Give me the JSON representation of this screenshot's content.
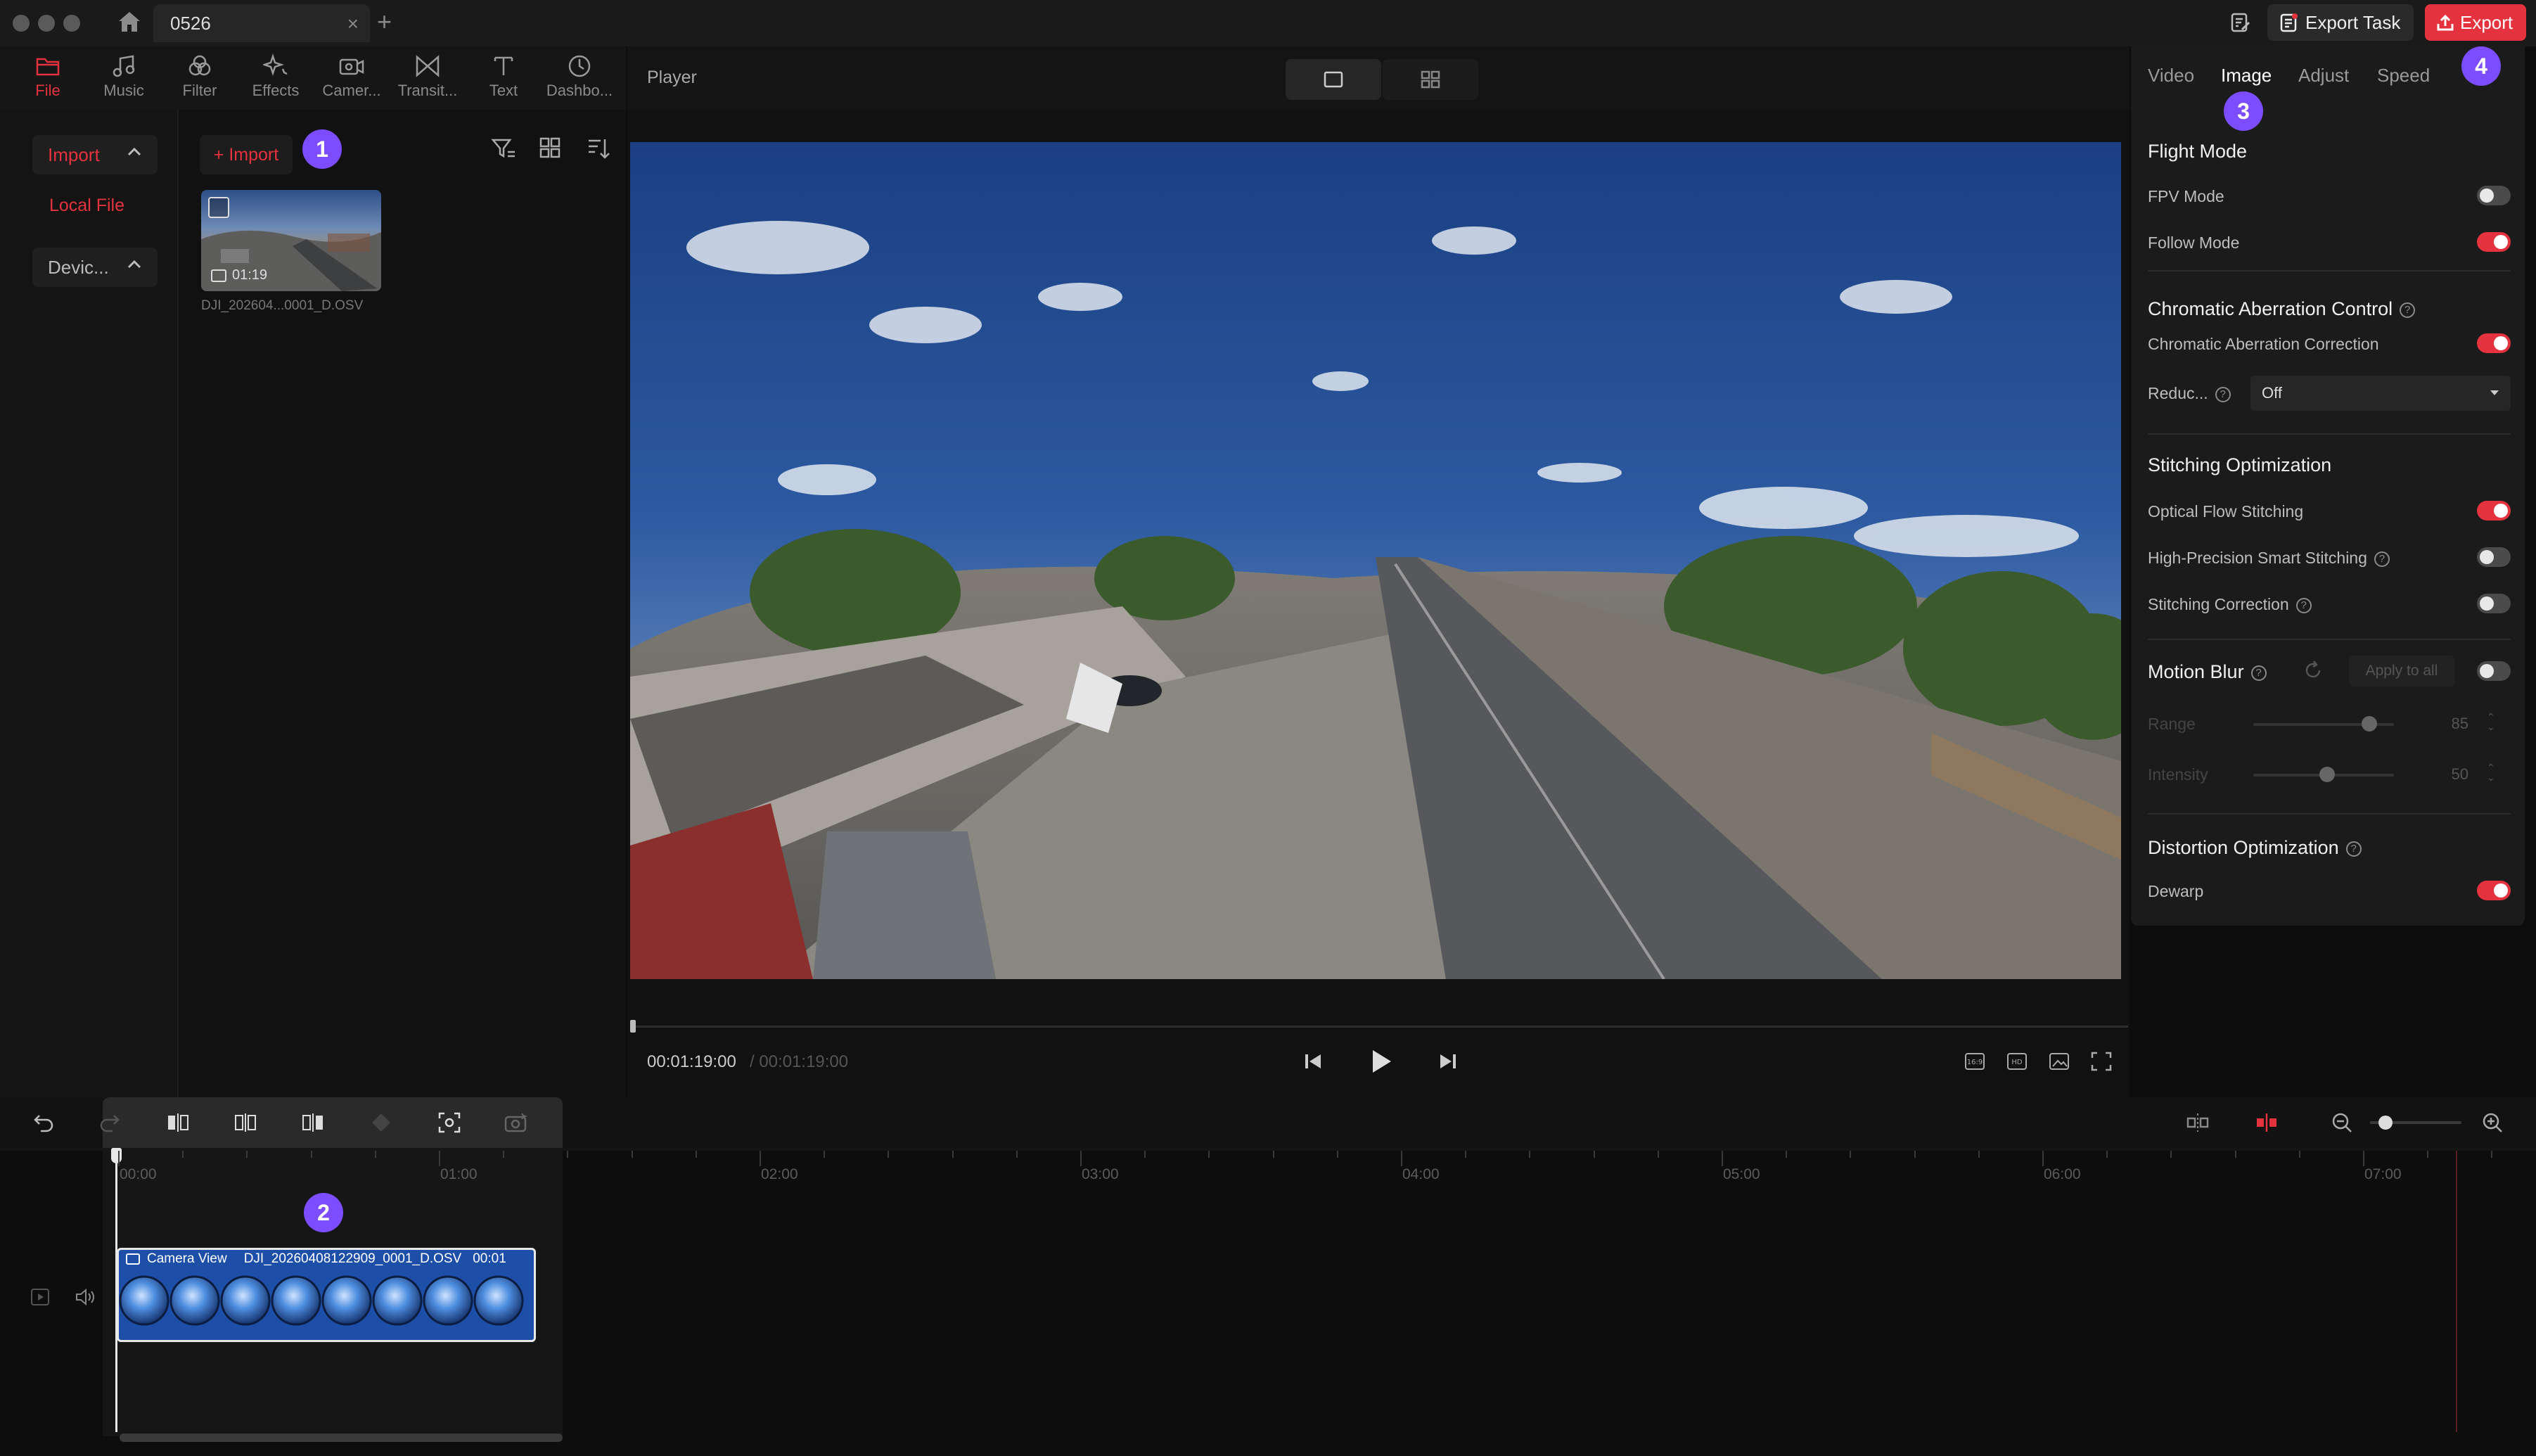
{
  "titlebar": {
    "tab_title": "0526",
    "export_task_label": "Export Task",
    "export_label": "Export",
    "export_badge": "4"
  },
  "toolbar": {
    "tools": [
      {
        "label": "File",
        "icon": "folder-icon",
        "active": true
      },
      {
        "label": "Music",
        "icon": "music-note-icon"
      },
      {
        "label": "Filter",
        "icon": "filter-circles-icon"
      },
      {
        "label": "Effects",
        "icon": "sparkle-icon"
      },
      {
        "label": "Camer...",
        "icon": "camera-view-icon"
      },
      {
        "label": "Transit...",
        "icon": "transition-icon"
      },
      {
        "label": "Text",
        "icon": "text-icon"
      },
      {
        "label": "Dashbo...",
        "icon": "dashboard-gauge-icon"
      }
    ]
  },
  "leftnav": {
    "import_label": "Import",
    "local_file_label": "Local File",
    "device_label": "Devic..."
  },
  "media": {
    "import_button_label": "+ Import",
    "badge": "1",
    "clip_name": "DJI_202604...0001_D.OSV",
    "clip_duration": "01:19"
  },
  "player": {
    "title": "Player",
    "current_time": "00:01:19:00",
    "total_time": "/ 00:01:19:00"
  },
  "right_panel": {
    "tabs": [
      "Video",
      "Image",
      "Adjust",
      "Speed"
    ],
    "active_tab": "Image",
    "badge": "3",
    "sections": {
      "flight_mode": {
        "title": "Flight Mode",
        "fpv_mode": {
          "label": "FPV Mode",
          "on": false
        },
        "follow_mode": {
          "label": "Follow Mode",
          "on": true
        }
      },
      "chromatic": {
        "title": "Chromatic Aberration Control",
        "correction": {
          "label": "Chromatic Aberration Correction",
          "on": true
        },
        "reduce_label": "Reduc...",
        "reduce_value": "Off"
      },
      "stitching": {
        "title": "Stitching Optimization",
        "optical_flow": {
          "label": "Optical Flow Stitching",
          "on": true
        },
        "high_precision": {
          "label": "High-Precision Smart Stitching",
          "on": false
        },
        "correction": {
          "label": "Stitching Correction",
          "on": false
        }
      },
      "motion_blur": {
        "title": "Motion Blur",
        "apply_all_label": "Apply to all",
        "on": false,
        "range_label": "Range",
        "range_value": "85",
        "intensity_label": "Intensity",
        "intensity_value": "50"
      },
      "distortion": {
        "title": "Distortion Optimization",
        "dewarp": {
          "label": "Dewarp",
          "on": true
        }
      }
    }
  },
  "timeline": {
    "ruler": [
      "00:00",
      "01:00",
      "02:00",
      "03:00",
      "04:00",
      "05:00",
      "06:00",
      "07:00"
    ],
    "badge": "2",
    "clip_tag": "Camera View",
    "clip_name": "DJI_20260408122909_0001_D.OSV",
    "clip_time": "00:01",
    "zoom_level": 0.35
  },
  "colors": {
    "accent": "#e5323f",
    "badge": "#7c4dff",
    "clip_blue": "#1e4fa8"
  }
}
